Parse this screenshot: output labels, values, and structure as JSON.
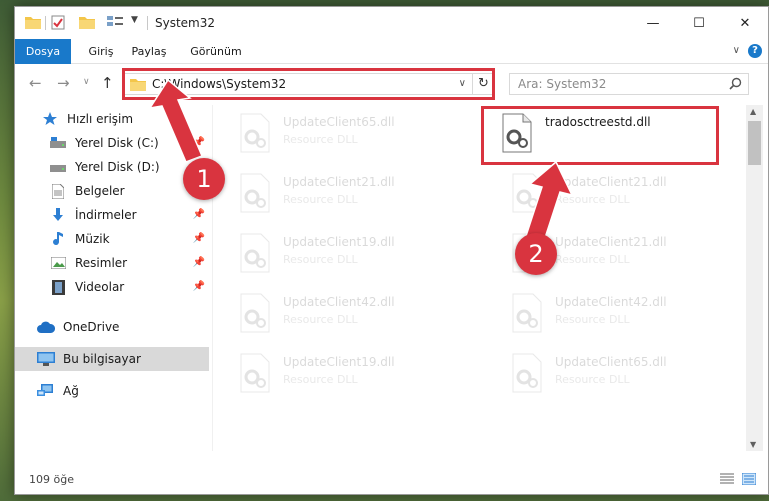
{
  "window": {
    "title": "System32",
    "controls": {
      "minimize": "—",
      "maximize": "☐",
      "close": "✕"
    }
  },
  "ribbon": {
    "tabs": [
      {
        "label": "Dosya"
      },
      {
        "label": "Giriş"
      },
      {
        "label": "Paylaş"
      },
      {
        "label": "Görünüm"
      }
    ],
    "help": "?"
  },
  "nav": {
    "address": "C:\\Windows\\System32",
    "search_placeholder": "Ara: System32"
  },
  "sidebar": {
    "items": [
      {
        "label": "Hızlı erişim",
        "icon": "star-icon"
      },
      {
        "label": "Yerel Disk (C:)",
        "icon": "drive-icon"
      },
      {
        "label": "Yerel Disk (D:)",
        "icon": "drive-icon"
      },
      {
        "label": "Belgeler",
        "icon": "document-icon"
      },
      {
        "label": "İndirmeler",
        "icon": "download-icon"
      },
      {
        "label": "Müzik",
        "icon": "music-icon"
      },
      {
        "label": "Resimler",
        "icon": "pictures-icon"
      },
      {
        "label": "Videolar",
        "icon": "video-icon"
      },
      {
        "label": "OneDrive",
        "icon": "cloud-icon"
      },
      {
        "label": "Bu bilgisayar",
        "icon": "computer-icon",
        "selected": true
      },
      {
        "label": "Ağ",
        "icon": "network-icon"
      }
    ]
  },
  "files": {
    "left_column": [
      {
        "name": "UpdateClient65.dll",
        "type": "Resource DLL"
      },
      {
        "name": "UpdateClient21.dll",
        "type": "Resource DLL"
      },
      {
        "name": "UpdateClient19.dll",
        "type": "Resource DLL"
      },
      {
        "name": "UpdateClient42.dll",
        "type": "Resource DLL"
      },
      {
        "name": "UpdateClient19.dll",
        "type": "Resource DLL"
      }
    ],
    "right_column": [
      {
        "name": "tradosctreestd.dll",
        "type": ""
      },
      {
        "name": "UpdateClient21.dll",
        "type": "Resource DLL"
      },
      {
        "name": "UpdateClient21.dll",
        "type": "Resource DLL"
      },
      {
        "name": "UpdateClient42.dll",
        "type": "Resource DLL"
      },
      {
        "name": "UpdateClient65.dll",
        "type": "Resource DLL"
      }
    ]
  },
  "status": {
    "item_count": "109 öğe"
  },
  "annotations": {
    "step1": "1",
    "step2": "2",
    "color": "#d9343f"
  }
}
